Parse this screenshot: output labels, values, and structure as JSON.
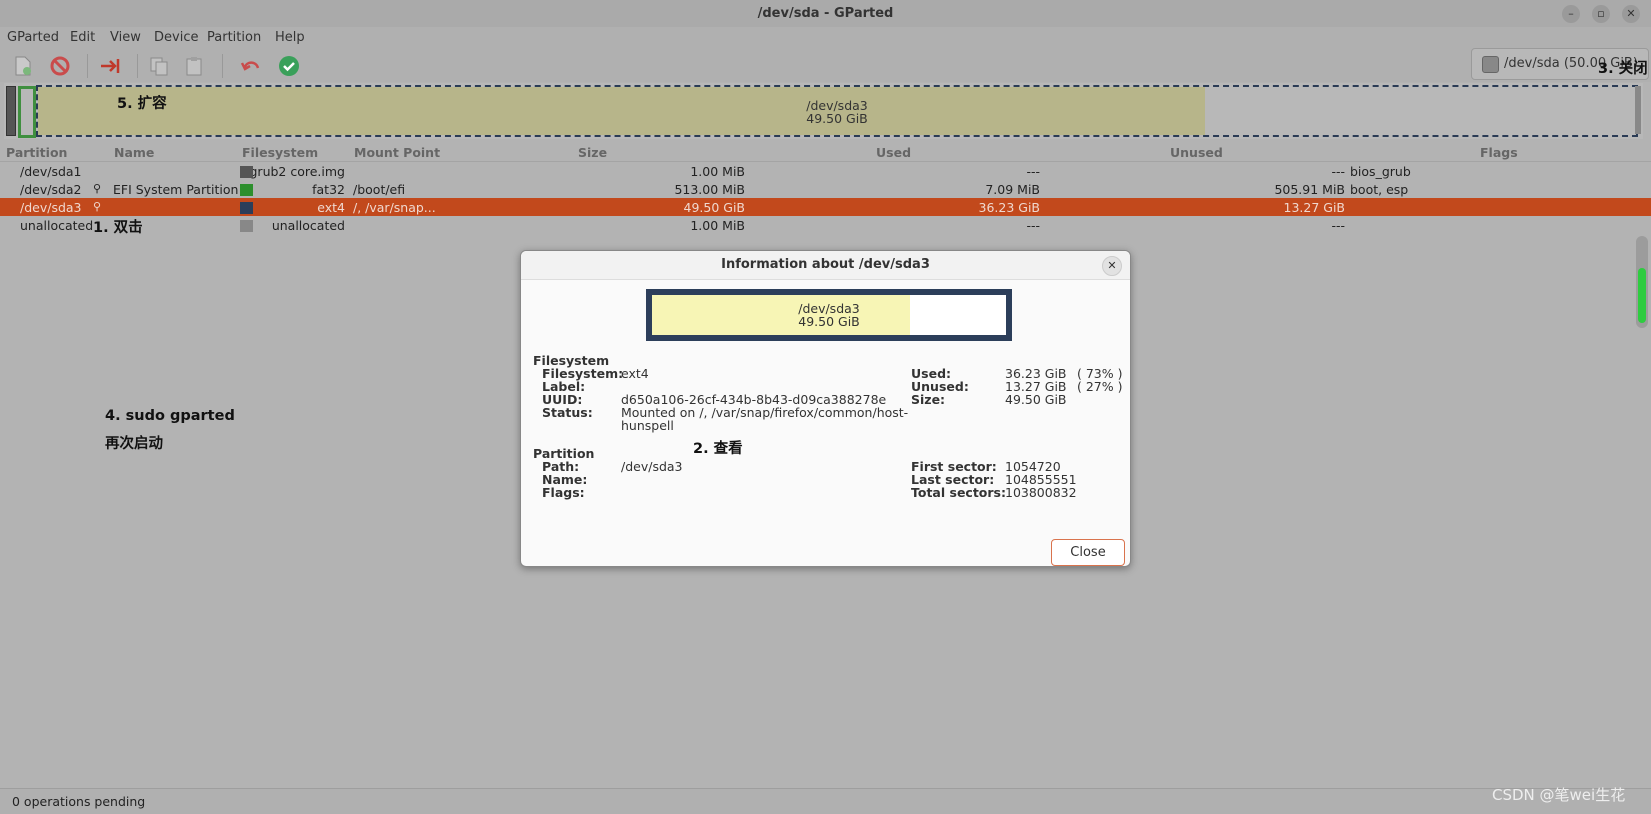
{
  "window": {
    "title": "/dev/sda - GParted"
  },
  "menubar": [
    "GParted",
    "Edit",
    "View",
    "Device",
    "Partition",
    "Help"
  ],
  "toolbar": {
    "icons": [
      "new-icon",
      "delete-icon",
      "resize-move-icon",
      "copy-icon",
      "paste-icon",
      "undo-icon",
      "apply-icon"
    ],
    "device_selector": "/dev/sda (50.00 GiB)"
  },
  "partition_bar": {
    "selected_name": "/dev/sda3",
    "selected_size": "49.50 GiB",
    "used_fraction": 0.73
  },
  "table": {
    "headers": [
      "Partition",
      "Name",
      "Filesystem",
      "Mount Point",
      "Size",
      "Used",
      "Unused",
      "Flags"
    ],
    "rows": [
      {
        "partition": "/dev/sda1",
        "name": "",
        "fs_color": "#555555",
        "filesystem": "grub2 core.img",
        "mount": "",
        "size": "1.00 MiB",
        "used": "---",
        "unused": "---",
        "flags": "bios_grub",
        "key": false
      },
      {
        "partition": "/dev/sda2",
        "name": "EFI System Partition",
        "fs_color": "#2d8f2d",
        "filesystem": "fat32",
        "mount": "/boot/efi",
        "size": "513.00 MiB",
        "used": "7.09 MiB",
        "unused": "505.91 MiB",
        "flags": "boot, esp",
        "key": true
      },
      {
        "partition": "/dev/sda3",
        "name": "",
        "fs_color": "#2c3e5a",
        "filesystem": "ext4",
        "mount": "/, /var/snap...",
        "size": "49.50 GiB",
        "used": "36.23 GiB",
        "unused": "13.27 GiB",
        "flags": "",
        "key": true
      },
      {
        "partition": "unallocated",
        "name": "",
        "fs_color": "#888888",
        "filesystem": "unallocated",
        "mount": "",
        "size": "1.00 MiB",
        "used": "---",
        "unused": "---",
        "flags": "",
        "key": false
      }
    ]
  },
  "annotations": {
    "a1": "1. 双击",
    "a2": "2. 查看",
    "a3": "3. 关闭",
    "a4_line1": "4. sudo gparted",
    "a4_line2": "再次启动",
    "a5": "5. 扩容"
  },
  "dialog": {
    "title": "Information about /dev/sda3",
    "bar_name": "/dev/sda3",
    "bar_size": "49.50 GiB",
    "filesystem_section": "Filesystem",
    "fs_labels": [
      "Filesystem:",
      "Label:",
      "UUID:",
      "Status:"
    ],
    "fs_values": [
      "ext4",
      "",
      "d650a106-26cf-434b-8b43-d09ca388278e",
      "Mounted on /, /var/snap/firefox/common/host-",
      "hunspell"
    ],
    "usage_labels": [
      "Used:",
      "Unused:",
      "Size:"
    ],
    "usage_values": [
      "36.23 GiB",
      "13.27 GiB",
      "49.50 GiB"
    ],
    "usage_pct": [
      "( 73% )",
      "( 27% )"
    ],
    "partition_section": "Partition",
    "part_labels": [
      "Path:",
      "Name:",
      "Flags:"
    ],
    "part_values": [
      "/dev/sda3",
      "",
      ""
    ],
    "sector_labels": [
      "First sector:",
      "Last sector:",
      "Total sectors:"
    ],
    "sector_values": [
      "1054720",
      "104855551",
      "103800832"
    ],
    "close_button": "Close"
  },
  "status": {
    "text": "0 operations pending"
  },
  "watermark": "CSDN @笔wei生花"
}
